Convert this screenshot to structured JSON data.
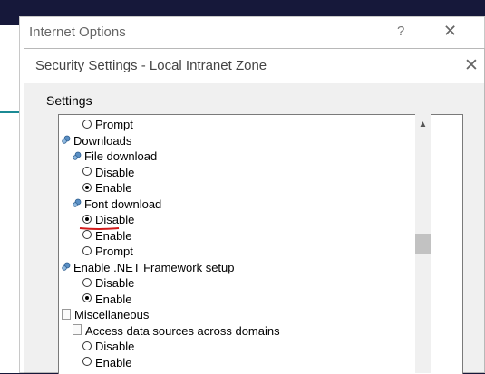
{
  "outer_dialog": {
    "title": "Internet Options",
    "help_glyph": "?",
    "close_glyph": "✕"
  },
  "security_dialog": {
    "title": "Security Settings - Local Intranet Zone",
    "close_glyph": "✕",
    "settings_label": "Settings"
  },
  "settings_tree": [
    {
      "kind": "radio",
      "label": "Prompt",
      "checked": false,
      "indent": 2
    },
    {
      "kind": "category",
      "icon": "gear-icon",
      "label": "Downloads",
      "indent": 0
    },
    {
      "kind": "category",
      "icon": "gear-icon",
      "label": "File download",
      "indent": 1
    },
    {
      "kind": "radio",
      "label": "Disable",
      "checked": false,
      "indent": 2
    },
    {
      "kind": "radio",
      "label": "Enable",
      "checked": true,
      "indent": 2
    },
    {
      "kind": "category",
      "icon": "gear-icon",
      "label": "Font download",
      "indent": 1
    },
    {
      "kind": "radio",
      "label": "Disable",
      "checked": true,
      "indent": 2
    },
    {
      "kind": "radio",
      "label": "Enable",
      "checked": false,
      "indent": 2
    },
    {
      "kind": "radio",
      "label": "Prompt",
      "checked": false,
      "indent": 2
    },
    {
      "kind": "category",
      "icon": "gear-icon",
      "label": "Enable .NET Framework setup",
      "indent": 0
    },
    {
      "kind": "radio",
      "label": "Disable",
      "checked": false,
      "indent": 1
    },
    {
      "kind": "radio",
      "label": "Enable",
      "checked": true,
      "indent": 1
    },
    {
      "kind": "category",
      "icon": "document-icon",
      "label": "Miscellaneous",
      "indent": 0
    },
    {
      "kind": "category",
      "icon": "document-icon",
      "label": "Access data sources across domains",
      "indent": 1
    },
    {
      "kind": "radio",
      "label": "Disable",
      "checked": false,
      "indent": 2
    },
    {
      "kind": "radio",
      "label": "Enable",
      "checked": false,
      "indent": 2
    }
  ],
  "scrollbar": {
    "up_glyph": "▲",
    "position_fraction": 0.45
  },
  "colors": {
    "taskbar": "#16183a",
    "annotation_underline": "#d11a1a",
    "teal_accent": "#1b8a94"
  }
}
